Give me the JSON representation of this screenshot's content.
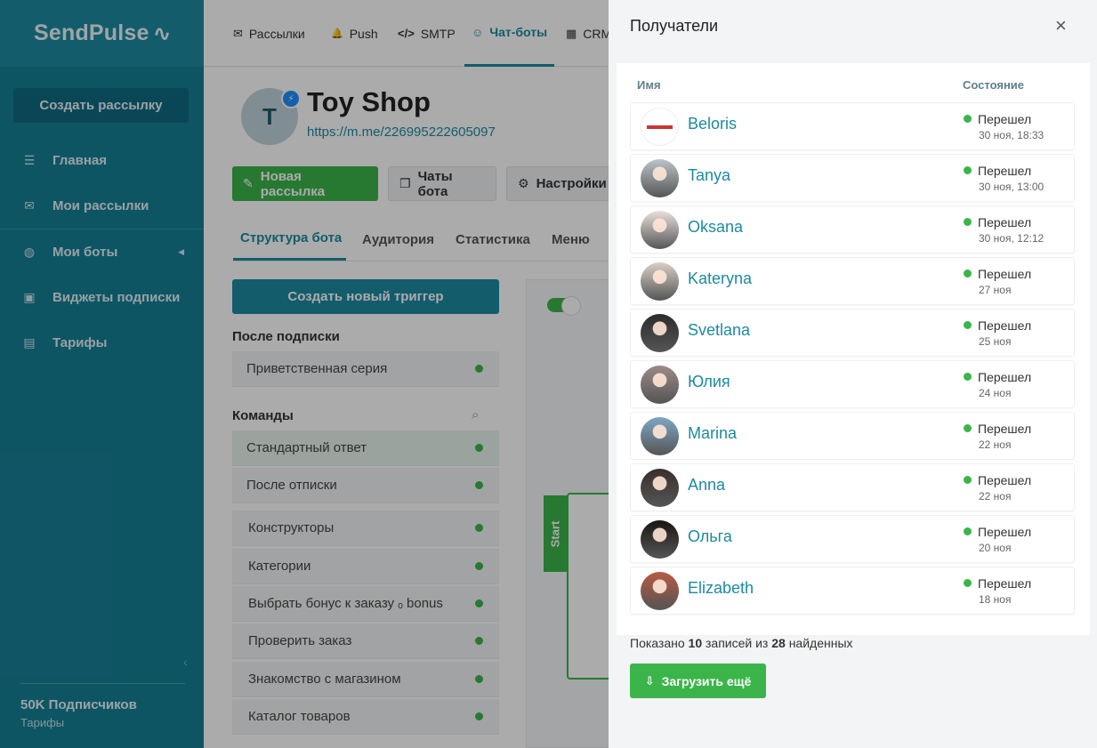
{
  "brand": {
    "name": "SendPulse",
    "pulse_glyph": "∿"
  },
  "sidebar": {
    "create_label": "Создать рассылку",
    "items": [
      {
        "icon": "sliders-icon",
        "glyph": "☰",
        "label": "Главная"
      },
      {
        "icon": "envelope-box-icon",
        "glyph": "✉",
        "label": "Мои рассылки"
      },
      {
        "icon": "globe-icon",
        "glyph": "◍",
        "label": "Мои боты",
        "arrow": "◀"
      },
      {
        "icon": "widget-icon",
        "glyph": "▣",
        "label": "Виджеты подписки"
      },
      {
        "icon": "wallet-icon",
        "glyph": "▤",
        "label": "Тарифы"
      }
    ],
    "collapse_glyph": "‹",
    "subscribers": "50K Подписчиков",
    "tariffs_link": "Тарифы"
  },
  "topnav": {
    "items": [
      {
        "icon": "mail-icon",
        "glyph": "✉",
        "label": "Рассылки"
      },
      {
        "icon": "bell-icon",
        "glyph": "🔔",
        "label": "Push"
      },
      {
        "icon": "code-icon",
        "glyph": "</>",
        "label": "SMTP"
      },
      {
        "icon": "chatbot-icon",
        "glyph": "☺",
        "label": "Чат-боты"
      },
      {
        "icon": "crm-icon",
        "glyph": "▦",
        "label": "CRM"
      }
    ]
  },
  "bot": {
    "avatar_letter": "T",
    "name": "Toy Shop",
    "link": "https://m.me/226995222605097",
    "messenger_glyph": "⚡"
  },
  "actions": {
    "new_campaign": "Новая рассылка",
    "chats": "Чаты бота",
    "settings": "Настройки"
  },
  "tabs": [
    "Структура бота",
    "Аудитория",
    "Статистика",
    "Меню"
  ],
  "triggers": {
    "create_label": "Создать новый триггер",
    "after_sub_title": "После подписки",
    "after_sub_items": [
      "Приветственная серия"
    ],
    "commands_title": "Команды",
    "command_items": [
      "Стандартный ответ",
      "После отписки"
    ],
    "flow_items": [
      "Конструкторы",
      "Категории",
      "Выбрать бонус к заказу ₒ bonus",
      "Проверить заказ",
      "Знакомство с магазином",
      "Каталог товаров"
    ]
  },
  "flow": {
    "start_label": "Start"
  },
  "drawer": {
    "title": "Получатели",
    "close_glyph": "×",
    "col_name": "Имя",
    "col_state": "Состояние",
    "recipients": [
      {
        "name": "Beloris",
        "state": "Перешел",
        "date": "30 ноя, 18:33",
        "avatar": "#ffffff"
      },
      {
        "name": "Tanya",
        "state": "Перешел",
        "date": "30 ноя, 13:00",
        "avatar": "#b9c4c9"
      },
      {
        "name": "Oksana",
        "state": "Перешел",
        "date": "30 ноя, 12:12",
        "avatar": "#e9dfdc"
      },
      {
        "name": "Kateryna",
        "state": "Перешел",
        "date": "27 ноя",
        "avatar": "#d9cfc6"
      },
      {
        "name": "Svetlana",
        "state": "Перешел",
        "date": "25 ноя",
        "avatar": "#2c2c2c"
      },
      {
        "name": "Юлия",
        "state": "Перешел",
        "date": "24 ноя",
        "avatar": "#9b8a86"
      },
      {
        "name": "Marina",
        "state": "Перешел",
        "date": "22 ноя",
        "avatar": "#7fa6c4"
      },
      {
        "name": "Anna",
        "state": "Перешел",
        "date": "22 ноя",
        "avatar": "#3a2e2c"
      },
      {
        "name": "Ольга",
        "state": "Перешел",
        "date": "20 ноя",
        "avatar": "#1a1512"
      },
      {
        "name": "Elizabeth",
        "state": "Перешел",
        "date": "18 ноя",
        "avatar": "#b55a43"
      }
    ],
    "shown_prefix": "Показано",
    "shown_count": "10",
    "shown_middle": "записей из",
    "shown_total": "28",
    "shown_suffix": "найденных",
    "load_more": "Загрузить ещё"
  },
  "colors": {
    "accent": "#1d8aa1",
    "sidebar": "#167f96",
    "success": "#3bb54a"
  }
}
